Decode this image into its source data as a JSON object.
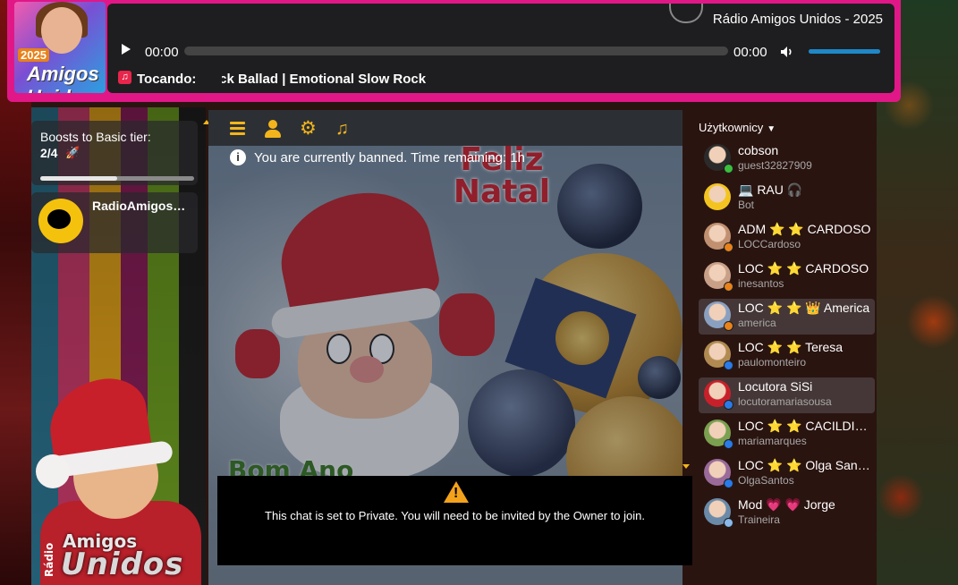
{
  "player": {
    "station_title": "Rádio Amigos Unidos - 2025",
    "current_time": "00:00",
    "duration": "00:00",
    "progress": 0,
    "volume": 1.0,
    "now_playing_label": "Tocando:",
    "now_playing_track": "ock Ballad | Emotional Slow Rock",
    "album_year": "2025",
    "album_title": "Amigos Unidos",
    "accent_color": "#e11788"
  },
  "boosts": {
    "title": "Boosts to Basic tier:",
    "count": "2/4",
    "progress": 0.5
  },
  "room": {
    "name": "RadioAmigosUnidos"
  },
  "chat": {
    "ban_message": "You are currently banned. Time remaining: 1h",
    "background_title_line1": "Feliz",
    "background_title_line2": "Natal",
    "background_bottom_text": "Bom Ano",
    "private_message": "This chat is set to Private. You will need to be invited by the Owner to join."
  },
  "users_panel": {
    "header": "Użytkownicy",
    "users": [
      {
        "name": "cobson",
        "sub": "guest32827909",
        "status": "#3cbf3c",
        "avatar_color": "#2b2b2b",
        "highlight": false
      },
      {
        "name": "💻 RAU 🎧",
        "sub": "Bot",
        "status": "",
        "avatar_color": "#f3c420",
        "highlight": false
      },
      {
        "name": "ADM ⭐ ⭐ CARDOSO",
        "sub": "LOCCardoso",
        "status": "#e8821a",
        "avatar_color": "#c09070",
        "highlight": false
      },
      {
        "name": "LOC ⭐ ⭐ CARDOSO",
        "sub": "inesantos",
        "status": "#e8821a",
        "avatar_color": "#c8a088",
        "highlight": false
      },
      {
        "name": "LOC ⭐ ⭐ 👑 America",
        "sub": "america",
        "status": "#e8821a",
        "avatar_color": "#8aa0c0",
        "highlight": true
      },
      {
        "name": "LOC ⭐ ⭐ Teresa",
        "sub": "paulomonteiro",
        "status": "#2a7ae8",
        "avatar_color": "#b08a50",
        "highlight": false
      },
      {
        "name": "Locutora SiSi",
        "sub": "locutoramariasousa",
        "status": "#2a7ae8",
        "avatar_color": "#c8202a",
        "highlight": true
      },
      {
        "name": "LOC ⭐ ⭐ CACILDINHA",
        "sub": "mariamarques",
        "status": "#2a7ae8",
        "avatar_color": "#7aa050",
        "highlight": false
      },
      {
        "name": "LOC ⭐ ⭐ Olga Santos",
        "sub": "OlgaSantos",
        "status": "#2a7ae8",
        "avatar_color": "#9a6a9a",
        "highlight": false
      },
      {
        "name": "Mod 💗 💗 Jorge",
        "sub": "Traineira",
        "status": "#8ab8e8",
        "avatar_color": "#6a8aa8",
        "highlight": false
      }
    ]
  },
  "background_logo": {
    "line1": "Amigos",
    "line2": "Unidos",
    "side": "Rádio"
  }
}
